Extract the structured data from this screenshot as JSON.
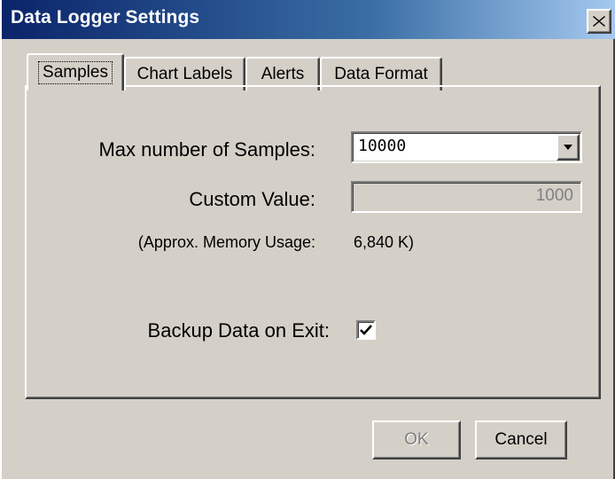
{
  "window": {
    "title": "Data Logger Settings",
    "close_icon": "close-icon"
  },
  "tabs": [
    {
      "label": "Samples",
      "active": true
    },
    {
      "label": "Chart Labels",
      "active": false
    },
    {
      "label": "Alerts",
      "active": false
    },
    {
      "label": "Data Format",
      "active": false
    }
  ],
  "samples": {
    "max_samples_label": "Max number of Samples:",
    "max_samples_value": "10000",
    "custom_value_label": "Custom Value:",
    "custom_value": "1000",
    "memory_label": "(Approx. Memory Usage:",
    "memory_value": "6,840 K)",
    "backup_label": "Backup Data on Exit:",
    "backup_checked": true
  },
  "buttons": {
    "ok": "OK",
    "cancel": "Cancel"
  },
  "colors": {
    "face": "#d4d0c8",
    "title_start": "#0a246a",
    "title_end": "#a6caf0",
    "disabled_text": "#808080"
  }
}
